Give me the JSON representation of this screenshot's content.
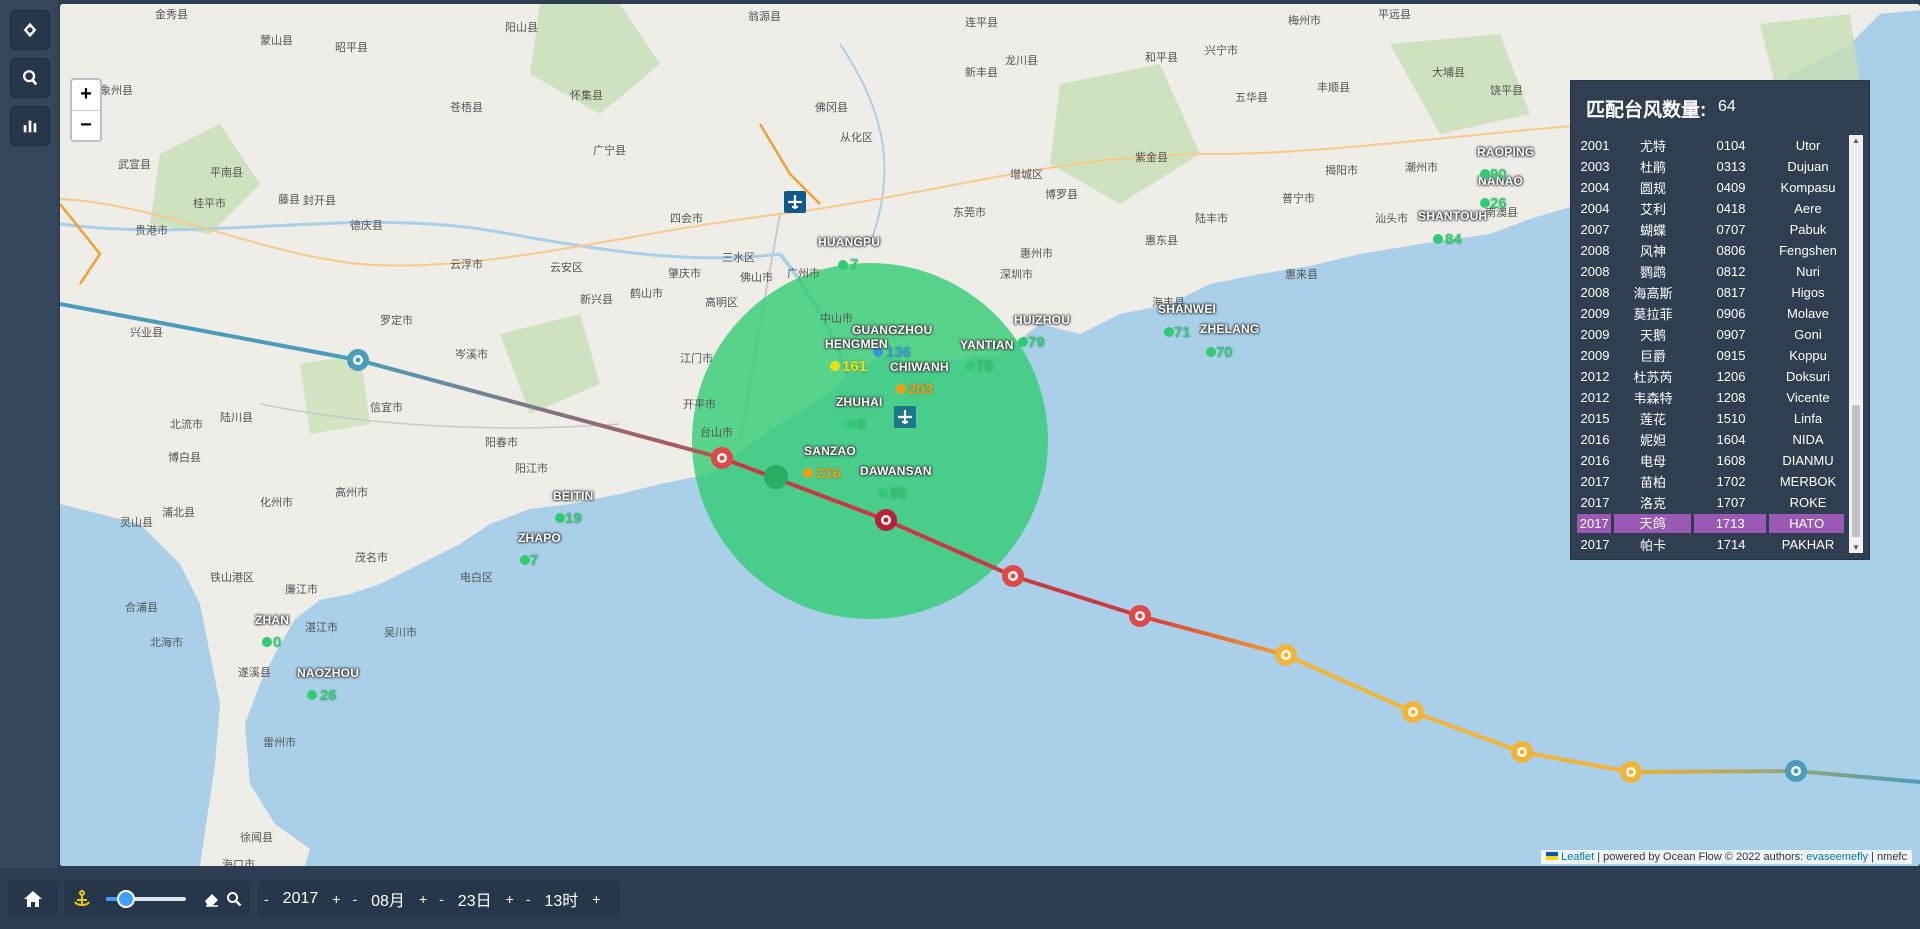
{
  "left_rail": {
    "icons": [
      "locate-icon",
      "search-icon",
      "chart-icon"
    ]
  },
  "map": {
    "zoom_in": "+",
    "zoom_out": "−",
    "places": [
      {
        "t": "金秀县"
      },
      {
        "t": "蒙山县"
      },
      {
        "t": "昭平县"
      },
      {
        "t": "阳山县"
      },
      {
        "t": "翁源县"
      },
      {
        "t": "连平县"
      },
      {
        "t": "龙川县"
      },
      {
        "t": "兴宁市"
      },
      {
        "t": "梅州市"
      },
      {
        "t": "平远县"
      },
      {
        "t": "象州县"
      },
      {
        "t": "苍梧县"
      },
      {
        "t": "怀集县"
      },
      {
        "t": "佛冈县"
      },
      {
        "t": "新丰县"
      },
      {
        "t": "和平县"
      },
      {
        "t": "五华县"
      },
      {
        "t": "丰顺县"
      },
      {
        "t": "大埔县"
      },
      {
        "t": "武宣县"
      },
      {
        "t": "平南县"
      },
      {
        "t": "封开县"
      },
      {
        "t": "广宁县"
      },
      {
        "t": "四会市"
      },
      {
        "t": "从化区"
      },
      {
        "t": "增城区"
      },
      {
        "t": "博罗县"
      },
      {
        "t": "紫金县"
      },
      {
        "t": "揭阳市"
      },
      {
        "t": "潮州市"
      },
      {
        "t": "饶平县"
      },
      {
        "t": "桂平市"
      },
      {
        "t": "藤县"
      },
      {
        "t": "德庆县"
      },
      {
        "t": "肇庆市"
      },
      {
        "t": "高明区"
      },
      {
        "t": "三水区"
      },
      {
        "t": "佛山市"
      },
      {
        "t": "广州市"
      },
      {
        "t": "东莞市"
      },
      {
        "t": "惠州市"
      },
      {
        "t": "惠东县"
      },
      {
        "t": "陆丰市"
      },
      {
        "t": "普宁市"
      },
      {
        "t": "汕头市"
      },
      {
        "t": "南澳县"
      },
      {
        "t": "贵港市"
      },
      {
        "t": "云浮市"
      },
      {
        "t": "云安区"
      },
      {
        "t": "新兴县"
      },
      {
        "t": "鹤山市"
      },
      {
        "t": "江门市"
      },
      {
        "t": "中山市"
      },
      {
        "t": "深圳市"
      },
      {
        "t": "海丰县"
      },
      {
        "t": "惠来县"
      },
      {
        "t": "兴业县"
      },
      {
        "t": "罗定市"
      },
      {
        "t": "岑溪市"
      },
      {
        "t": "开平市"
      },
      {
        "t": "台山市"
      },
      {
        "t": "阳春市"
      },
      {
        "t": "阳江市"
      },
      {
        "t": "信宜市"
      },
      {
        "t": "高州市"
      },
      {
        "t": "化州市"
      },
      {
        "t": "茂名市"
      },
      {
        "t": "电白区"
      },
      {
        "t": "吴川市"
      },
      {
        "t": "湛江市"
      },
      {
        "t": "廉江市"
      },
      {
        "t": "遂溪县"
      },
      {
        "t": "雷州市"
      },
      {
        "t": "徐闻县"
      },
      {
        "t": "北流市"
      },
      {
        "t": "陆川县"
      },
      {
        "t": "博白县"
      },
      {
        "t": "浦北县"
      },
      {
        "t": "灵山县"
      },
      {
        "t": "合浦县"
      },
      {
        "t": "北海市"
      },
      {
        "t": "铁山港区"
      },
      {
        "t": "海口市"
      }
    ],
    "stations": [
      {
        "name": "HUANGPU",
        "value": "7",
        "color": "#2ecc71"
      },
      {
        "name": "GUANGZHOU",
        "value": "136",
        "color": "#3498db"
      },
      {
        "name": "HENGMEN",
        "value": "161",
        "color": "#f1e011"
      },
      {
        "name": "CHIWANH",
        "value": "203",
        "color": "#f39c12"
      },
      {
        "name": "YANTIAN",
        "value": "75",
        "color": "#2ecc71"
      },
      {
        "name": "HUIZHOU",
        "value": "79",
        "color": "#2ecc71"
      },
      {
        "name": "ZHUHAI",
        "value": "0",
        "color": "#2ecc71"
      },
      {
        "name": "SANZAO",
        "value": "216",
        "color": "#f39c12"
      },
      {
        "name": "DAWANSAN",
        "value": "95",
        "color": "#2ecc71"
      },
      {
        "name": "SHANWEI",
        "value": "71",
        "color": "#2ecc71"
      },
      {
        "name": "ZHELANG",
        "value": "70",
        "color": "#2ecc71"
      },
      {
        "name": "SHANTOUH",
        "value": "84",
        "color": "#2ecc71"
      },
      {
        "name": "NANAO",
        "value": "26",
        "color": "#2ecc71"
      },
      {
        "name": "RAOPING",
        "value": "90",
        "color": "#2ecc71"
      },
      {
        "name": "BEITIN",
        "value": "19",
        "color": "#2ecc71"
      },
      {
        "name": "ZHAPO",
        "value": "7",
        "color": "#2ecc71"
      },
      {
        "name": "ZHAN",
        "value": "0",
        "color": "#2ecc71"
      },
      {
        "name": "NAOZHOU",
        "value": "26",
        "color": "#2ecc71"
      }
    ],
    "attribution": {
      "leaflet": "Leaflet",
      "text": "| powered by Ocean Flow © 2022 authors:",
      "author": "evaseemefly",
      "tail": "| nmefc"
    }
  },
  "panel": {
    "title": "匹配台风数量:",
    "count": "64",
    "rows": [
      {
        "year": "2001",
        "cn": "尤特",
        "code": "0104",
        "en": "Utor"
      },
      {
        "year": "2003",
        "cn": "杜鹃",
        "code": "0313",
        "en": "Dujuan"
      },
      {
        "year": "2004",
        "cn": "圆规",
        "code": "0409",
        "en": "Kompasu"
      },
      {
        "year": "2004",
        "cn": "艾利",
        "code": "0418",
        "en": "Aere"
      },
      {
        "year": "2007",
        "cn": "蝴蝶",
        "code": "0707",
        "en": "Pabuk"
      },
      {
        "year": "2008",
        "cn": "风神",
        "code": "0806",
        "en": "Fengshen"
      },
      {
        "year": "2008",
        "cn": "鹦鹉",
        "code": "0812",
        "en": "Nuri"
      },
      {
        "year": "2008",
        "cn": "海高斯",
        "code": "0817",
        "en": "Higos"
      },
      {
        "year": "2009",
        "cn": "莫拉菲",
        "code": "0906",
        "en": "Molave"
      },
      {
        "year": "2009",
        "cn": "天鹅",
        "code": "0907",
        "en": "Goni"
      },
      {
        "year": "2009",
        "cn": "巨爵",
        "code": "0915",
        "en": "Koppu"
      },
      {
        "year": "2012",
        "cn": "杜苏芮",
        "code": "1206",
        "en": "Doksuri"
      },
      {
        "year": "2012",
        "cn": "韦森特",
        "code": "1208",
        "en": "Vicente"
      },
      {
        "year": "2015",
        "cn": "莲花",
        "code": "1510",
        "en": "Linfa"
      },
      {
        "year": "2016",
        "cn": "妮妲",
        "code": "1604",
        "en": "NIDA"
      },
      {
        "year": "2016",
        "cn": "电母",
        "code": "1608",
        "en": "DIANMU"
      },
      {
        "year": "2017",
        "cn": "苗柏",
        "code": "1702",
        "en": "MERBOK"
      },
      {
        "year": "2017",
        "cn": "洛克",
        "code": "1707",
        "en": "ROKE"
      },
      {
        "year": "2017",
        "cn": "天鸽",
        "code": "1713",
        "en": "HATO",
        "selected": true
      },
      {
        "year": "2017",
        "cn": "帕卡",
        "code": "1714",
        "en": "PAKHAR"
      }
    ]
  },
  "bottom": {
    "minus": "-",
    "plus": "+",
    "year": "2017",
    "month": "08月",
    "day": "23日",
    "hour": "13时",
    "slider_value": 0.25
  },
  "colors": {
    "green_circle": "#2ecc71",
    "track_red": "#d63a3a",
    "track_orange": "#f0a030",
    "track_blue": "#4a9cb8",
    "selected": "#9b59b6"
  }
}
